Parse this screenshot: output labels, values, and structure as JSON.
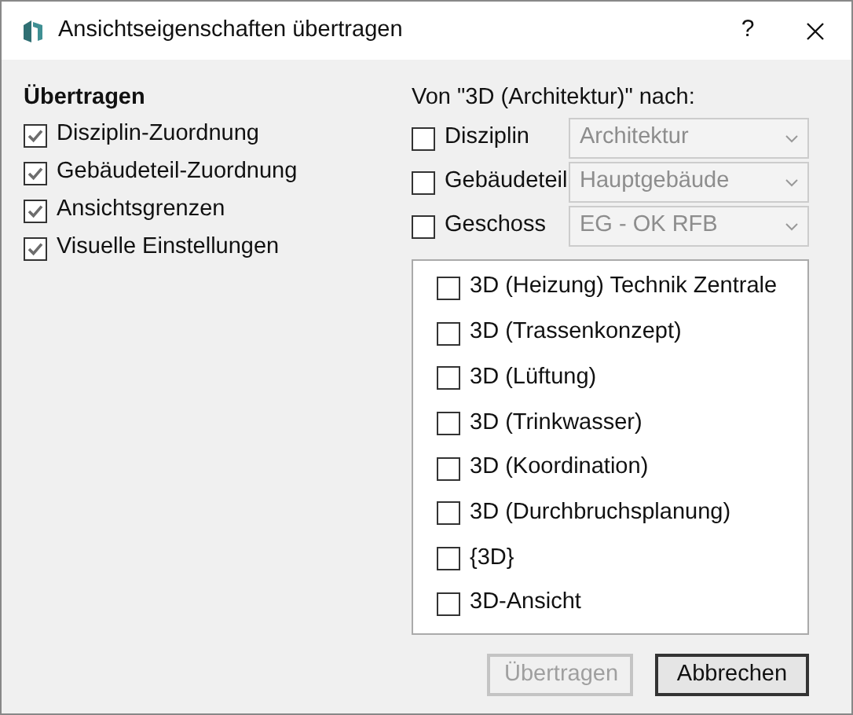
{
  "window": {
    "title": "Ansichtseigenschaften übertragen",
    "help": "?"
  },
  "transfer": {
    "heading": "Übertragen",
    "options": [
      {
        "label": "Disziplin-Zuordnung",
        "checked": true
      },
      {
        "label": "Gebäudeteil-Zuordnung",
        "checked": true
      },
      {
        "label": "Ansichtsgrenzen",
        "checked": true
      },
      {
        "label": "Visuelle Einstellungen",
        "checked": true
      }
    ]
  },
  "target": {
    "label": "Von \"3D (Architektur)\" nach:",
    "filters": [
      {
        "label": "Disziplin",
        "checked": false,
        "value": "Architektur",
        "disabled": true
      },
      {
        "label": "Gebäudeteil",
        "checked": false,
        "value": "Hauptgebäude",
        "disabled": true
      },
      {
        "label": "Geschoss",
        "checked": false,
        "value": "EG - OK RFB",
        "disabled": true
      }
    ],
    "views": [
      {
        "label": "3D (Heizung) Technik Zentrale",
        "checked": false
      },
      {
        "label": "3D (Trassenkonzept)",
        "checked": false
      },
      {
        "label": "3D (Lüftung)",
        "checked": false
      },
      {
        "label": "3D (Trinkwasser)",
        "checked": false
      },
      {
        "label": "3D (Koordination)",
        "checked": false
      },
      {
        "label": "3D (Durchbruchsplanung)",
        "checked": false
      },
      {
        "label": "{3D}",
        "checked": false
      },
      {
        "label": "3D-Ansicht",
        "checked": false
      }
    ]
  },
  "buttons": [
    {
      "label": "Übertragen",
      "disabled": true
    },
    {
      "label": "Abbrechen",
      "disabled": false
    }
  ]
}
